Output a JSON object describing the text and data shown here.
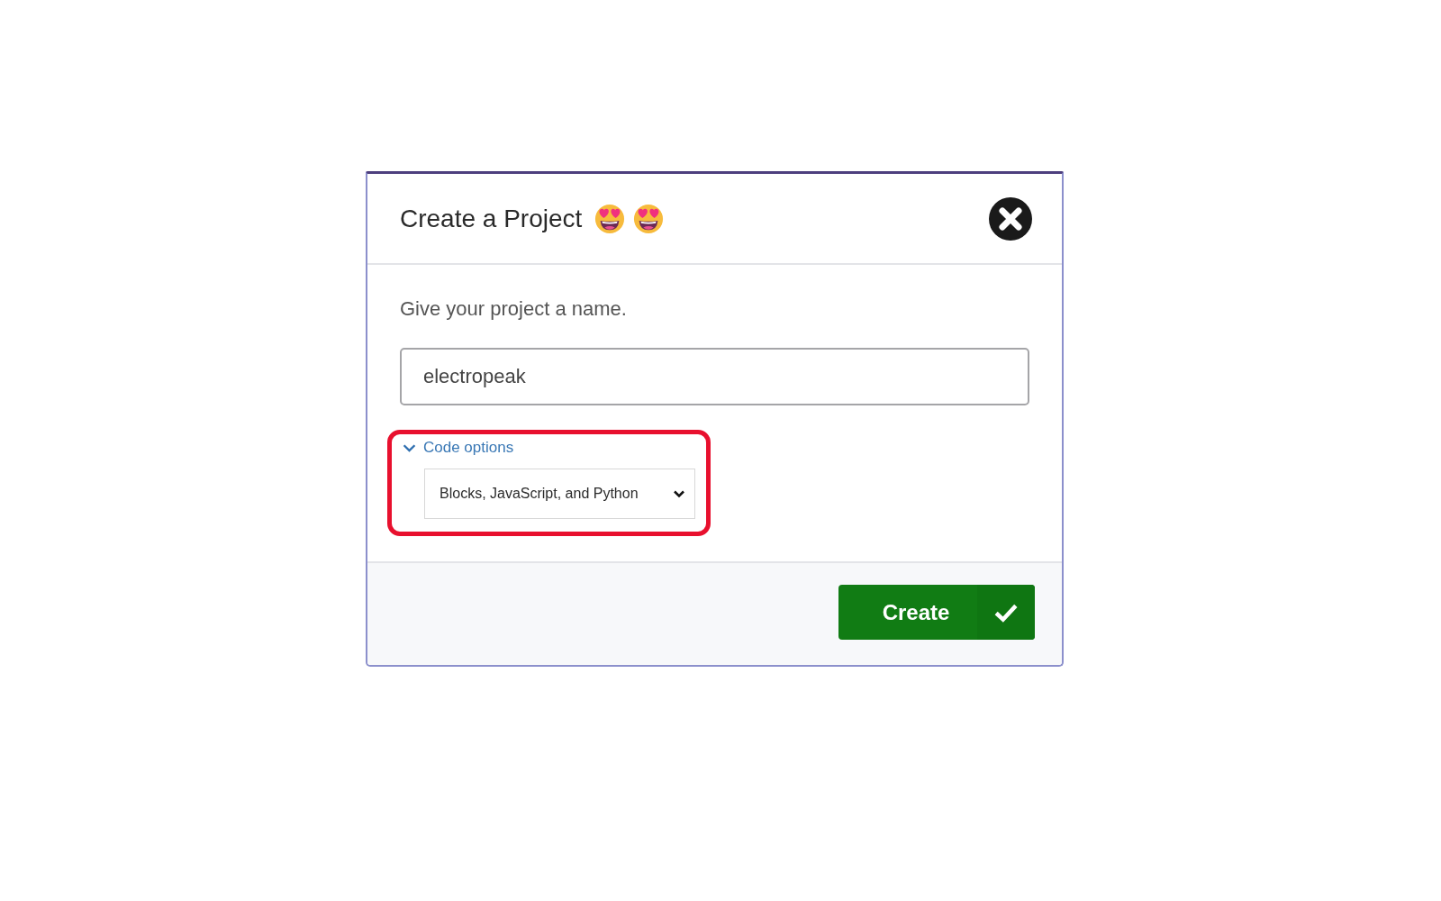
{
  "dialog": {
    "title": "Create a Project",
    "name_prompt": "Give your project a name.",
    "name_field": {
      "value": "electropeak"
    },
    "code_options": {
      "label": "Code options",
      "expanded": true,
      "highlighted": true,
      "language": "Blocks, JavaScript, and Python"
    },
    "create_button": {
      "label": "Create"
    }
  }
}
